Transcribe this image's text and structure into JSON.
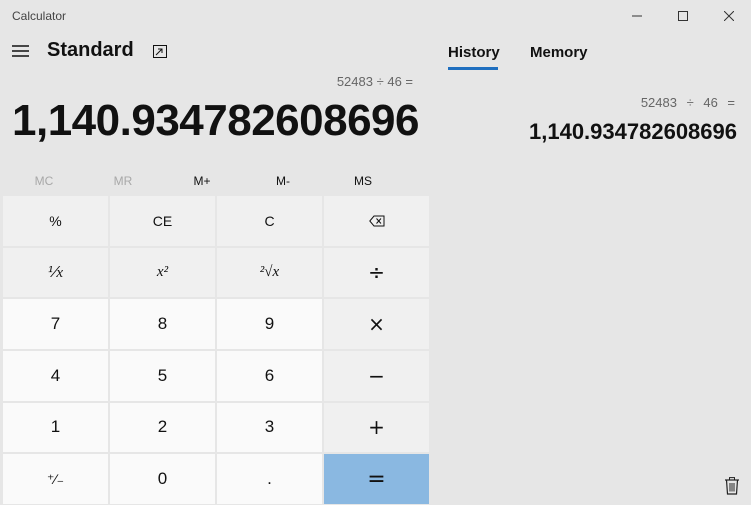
{
  "window": {
    "title": "Calculator"
  },
  "header": {
    "mode": "Standard"
  },
  "display": {
    "expression": "52483 ÷ 46 =",
    "result": "1,140.934782608696"
  },
  "memory": {
    "buttons": [
      "MC",
      "MR",
      "M+",
      "M-",
      "MS"
    ]
  },
  "keys": {
    "percent": "%",
    "ce": "CE",
    "c": "C",
    "backspace": "⌫",
    "reciprocal": "⅟x",
    "square": "x²",
    "sqrt": "²√x",
    "divide": "÷",
    "seven": "7",
    "eight": "8",
    "nine": "9",
    "multiply": "×",
    "four": "4",
    "five": "5",
    "six": "6",
    "minus": "−",
    "one": "1",
    "two": "2",
    "three": "3",
    "plus": "+",
    "negate": "⁺∕₋",
    "zero": "0",
    "decimal": ".",
    "equals": "="
  },
  "panel": {
    "tabs": [
      "History",
      "Memory"
    ],
    "history": [
      {
        "expression": "52483 ÷ 46 =",
        "result": "1,140.934782608696"
      }
    ]
  },
  "colors": {
    "background": "#e6e6e6",
    "equals_key": "#8ab8e1",
    "tab_accent": "#1f6fbf"
  }
}
